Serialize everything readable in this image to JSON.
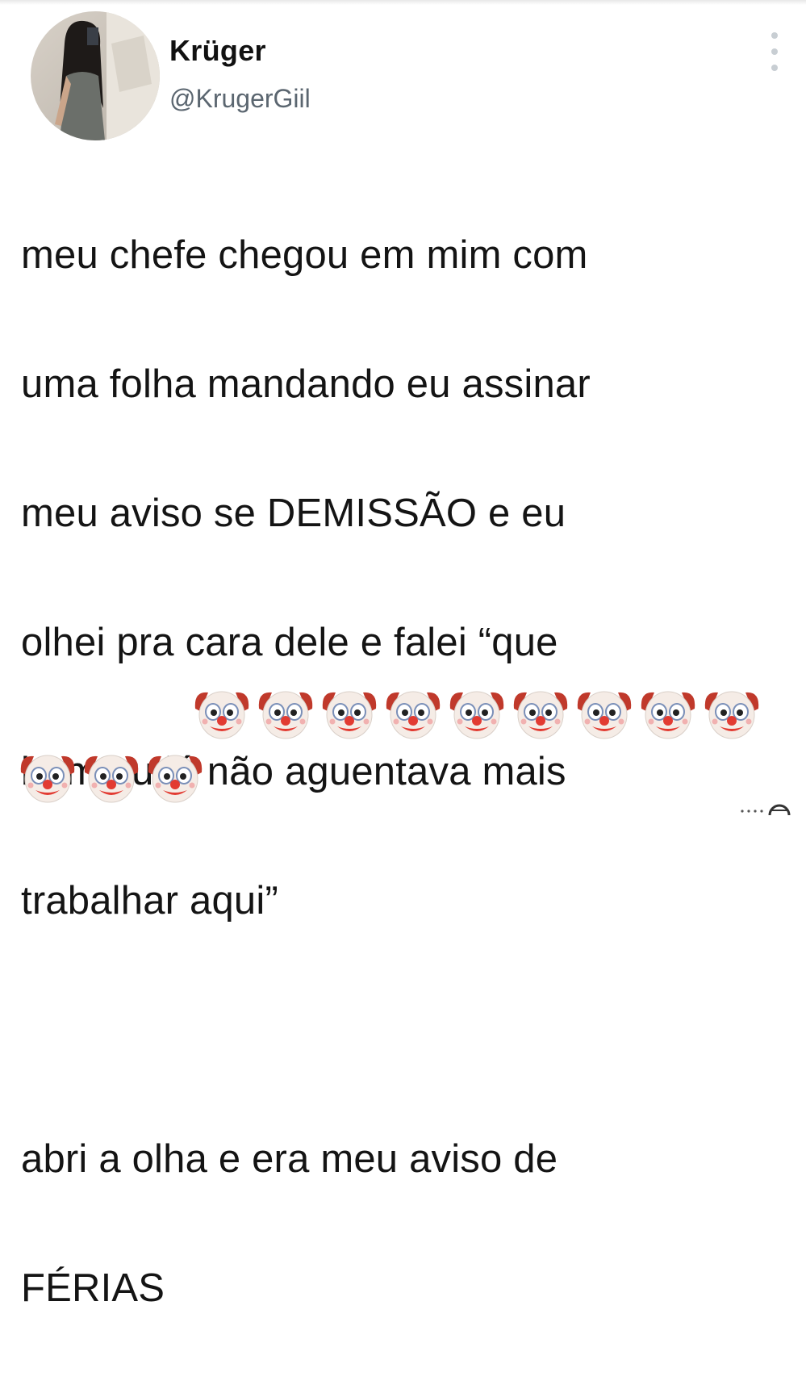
{
  "tweet": {
    "display_name": "Krüger",
    "handle": "@KrugerGiil",
    "text_lines": [
      "meu chefe chegou em mim com",
      "uma folha mandando eu assinar",
      "meu aviso se DEMISSÃO e eu",
      "olhei pra cara dele e falei “que",
      "bom eu já não aguentava mais",
      "trabalhar aqui”",
      "",
      "abri a olha e era meu aviso de",
      "FÉRIAS"
    ],
    "emoji": "clown-face",
    "emoji_count": 12
  },
  "icons": {
    "more_menu": "vertical-ellipsis-icon",
    "avatar": "profile-photo",
    "corner": "more-indicator-icon"
  },
  "colors": {
    "text": "#141414",
    "handle": "#5b6670",
    "menu_dots": "#c8ced3"
  }
}
